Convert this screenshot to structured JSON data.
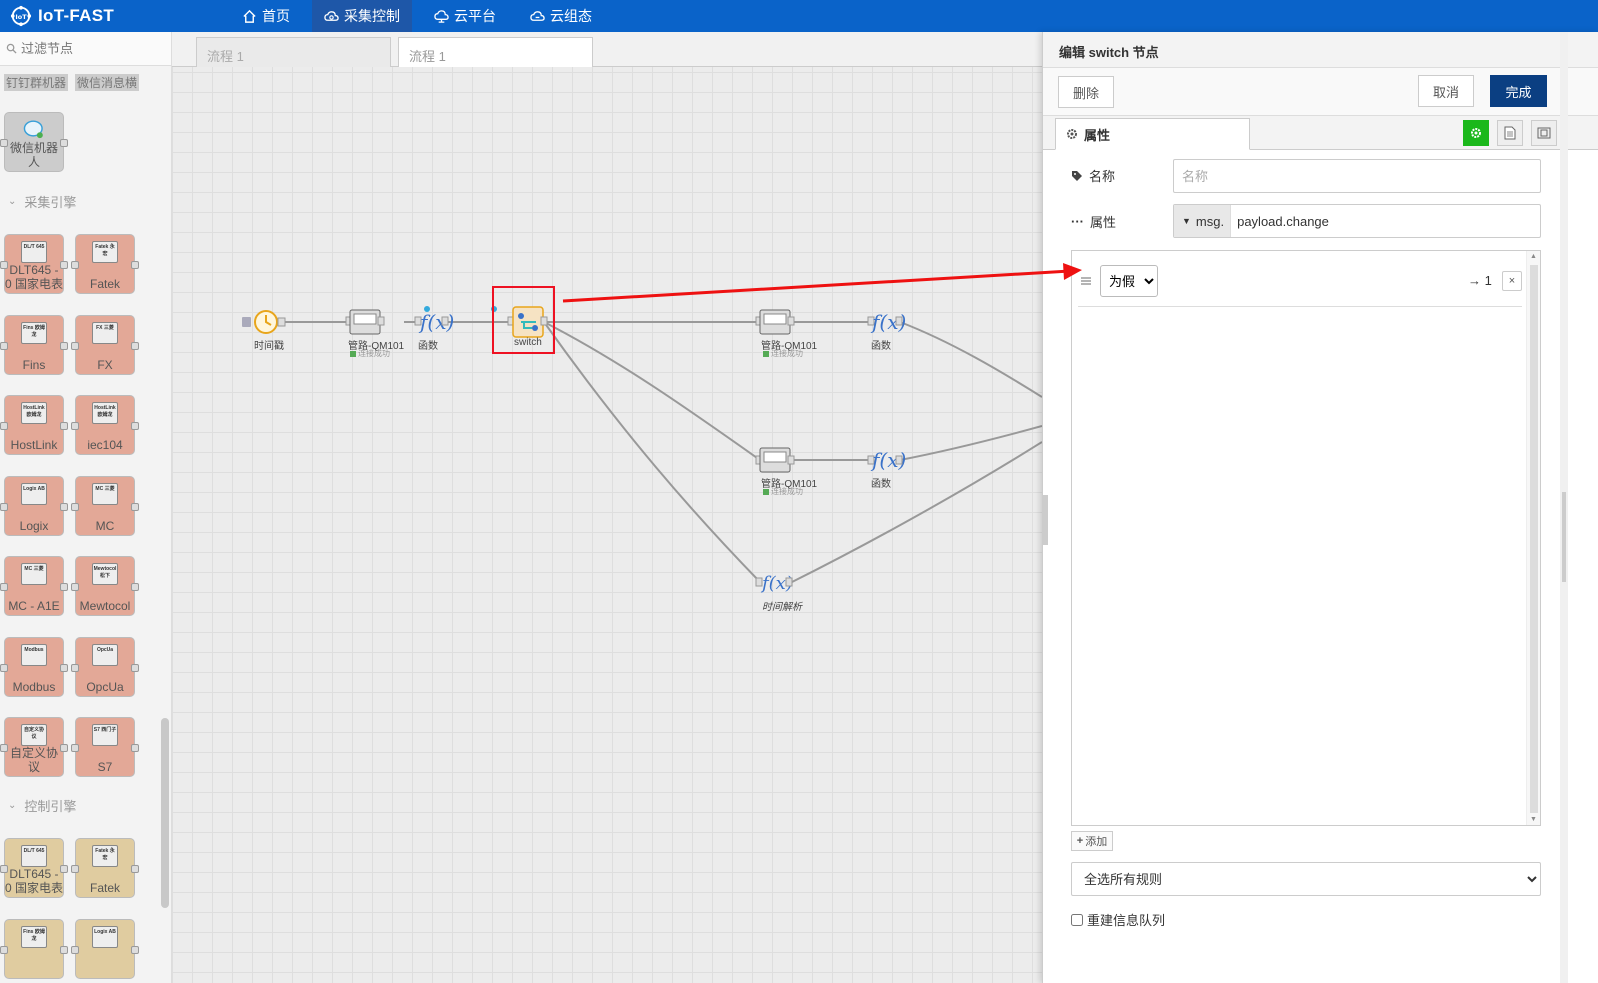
{
  "header": {
    "brand": "IoT-FAST",
    "nav": [
      {
        "label": "首页",
        "icon": "home-icon"
      },
      {
        "label": "采集控制",
        "icon": "cloud-gear-icon",
        "active": true
      },
      {
        "label": "云平台",
        "icon": "cloud-platform-icon"
      },
      {
        "label": "云组态",
        "icon": "cloud-config-icon"
      }
    ]
  },
  "palette": {
    "filter_placeholder": "过滤节点",
    "top_items": [
      "钉钉群机器",
      "微信消息横"
    ],
    "wechat_robot": "微信机器人",
    "sections": [
      {
        "title": "采集引擎",
        "nodes": [
          "DLT645 - 0 国家电表",
          "Fatek",
          "Fins",
          "FX",
          "HostLink",
          "iec104",
          "Logix",
          "MC",
          "MC - A1E",
          "Mewtocol",
          "Modbus",
          "OpcUa",
          "自定义协议",
          "S7"
        ]
      },
      {
        "title": "控制引擎",
        "nodes": [
          "DLT645 - 0 国家电表",
          "Fatek",
          "",
          ""
        ]
      }
    ],
    "chips": [
      "DL/T 645",
      "Fatek 永宏",
      "Fins 欧姆龙",
      "FX 三菱",
      "HostLink 欧姆龙",
      "HostLink 欧姆龙",
      "Logix AB",
      "MC 三菱",
      "MC 三菱",
      "Mewtocol 松下",
      "Modbus",
      "OpcUa",
      "自定义协议",
      "S7 西门子",
      "DL/T 645",
      "Fatek 永宏",
      "Fins 欧姆龙",
      "Logix AB"
    ]
  },
  "workspace": {
    "tabs": [
      "流程 1",
      "流程 1"
    ],
    "nodes": {
      "timestamp": "时间戳",
      "pipe1": "管路-QM101",
      "pipe1_status": "连接成功",
      "func1": "函数",
      "switch": "switch",
      "pipe2": "管路-QM101",
      "pipe2_status": "连接成功",
      "func2": "函数",
      "pipe3": "管路-QM101",
      "pipe3_status": "连接成功",
      "func3": "函数",
      "time_parse": "时间解析"
    }
  },
  "editor": {
    "title": "编辑 switch 节点",
    "delete_label": "删除",
    "cancel_label": "取消",
    "done_label": "完成",
    "properties_tab": "属性",
    "name_label": "名称",
    "name_placeholder": "名称",
    "property_label": "属性",
    "property_prefix": "msg.",
    "property_value": "payload.change",
    "rule": {
      "operator": "为假",
      "output": "→ 1",
      "remove": "×"
    },
    "add_label": "添加",
    "mode_option": "全选所有规则",
    "recreate_label": "重建信息队列"
  },
  "colors": {
    "header": "#0a63c9",
    "active_nav": "#1e57a8",
    "primary_button": "#0b3f82",
    "collect_node": "#e3a897",
    "control_node": "#e0cca0",
    "highlight": "#e11"
  }
}
